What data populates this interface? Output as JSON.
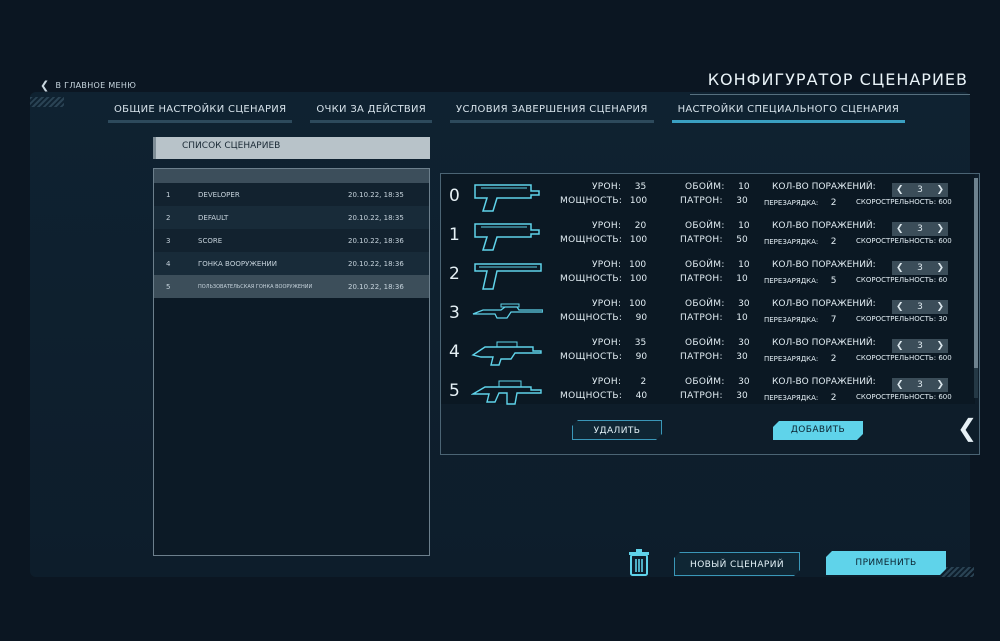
{
  "nav": {
    "back_label": "В ГЛАВНОЕ МЕНЮ"
  },
  "title": "КОНФИГУРАТОР СЦЕНАРИЕВ",
  "tabs": [
    {
      "label": "ОБЩИЕ НАСТРОЙКИ СЦЕНАРИЯ"
    },
    {
      "label": "ОЧКИ ЗА ДЕЙСТВИЯ"
    },
    {
      "label": "УСЛОВИЯ ЗАВЕРШЕНИЯ СЦЕНАРИЯ"
    },
    {
      "label": "НАСТРОЙКИ СПЕЦИАЛЬНОГО СЦЕНАРИЯ"
    }
  ],
  "scenario_list": {
    "header": "СПИСОК СЦЕНАРИЕВ",
    "rows": [
      {
        "num": "1",
        "name": "DEVELOPER",
        "date": "20.10.22, 18:35"
      },
      {
        "num": "2",
        "name": "DEFAULT",
        "date": "20.10.22, 18:35"
      },
      {
        "num": "3",
        "name": "SCORE",
        "date": "20.10.22, 18:36"
      },
      {
        "num": "4",
        "name": "ГОНКА ВООРУЖЕНИЙ",
        "date": "20.10.22, 18:36"
      },
      {
        "num": "5",
        "name": "ПОЛЬЗОВАТЕЛЬСКАЯ ГОНКА ВООРУЖЕНИЙ",
        "date": "20.10.22, 18:36"
      }
    ]
  },
  "labels": {
    "damage": "УРОН:",
    "power": "МОЩНОСТЬ:",
    "clips": "ОБОЙМ:",
    "ammo": "ПАТРОН:",
    "hits": "КОЛ-ВО ПОРАЖЕНИЙ:",
    "reload": "ПЕРЕЗАРЯДКА:",
    "rate": "СКОРОСТРЕЛЬНОСТЬ:"
  },
  "weapons": [
    {
      "index": "0",
      "gun_icon": "pistol-icon",
      "damage": "35",
      "power": "100",
      "clips": "10",
      "ammo": "30",
      "hits": "3",
      "reload": "2",
      "rate": "600"
    },
    {
      "index": "1",
      "gun_icon": "pistol-icon",
      "damage": "20",
      "power": "100",
      "clips": "10",
      "ammo": "50",
      "hits": "3",
      "reload": "2",
      "rate": "600"
    },
    {
      "index": "2",
      "gun_icon": "desert-eagle-icon",
      "damage": "100",
      "power": "100",
      "clips": "10",
      "ammo": "10",
      "hits": "3",
      "reload": "5",
      "rate": "60"
    },
    {
      "index": "3",
      "gun_icon": "sniper-rifle-icon",
      "damage": "100",
      "power": "90",
      "clips": "30",
      "ammo": "10",
      "hits": "3",
      "reload": "7",
      "rate": "30"
    },
    {
      "index": "4",
      "gun_icon": "shotgun-icon",
      "damage": "35",
      "power": "90",
      "clips": "30",
      "ammo": "30",
      "hits": "3",
      "reload": "2",
      "rate": "600"
    },
    {
      "index": "5",
      "gun_icon": "assault-rifle-icon",
      "damage": "2",
      "power": "40",
      "clips": "30",
      "ammo": "30",
      "hits": "3",
      "reload": "2",
      "rate": "600"
    }
  ],
  "buttons": {
    "delete": "УДАЛИТЬ",
    "add": "ДОБАВИТЬ",
    "new_scenario": "НОВЫЙ СЦЕНАРИЙ",
    "apply": "ПРИМЕНИТЬ"
  },
  "colors": {
    "accent": "#5fd3ea",
    "accent_dark": "#3a97b8",
    "background": "#0b1622"
  }
}
